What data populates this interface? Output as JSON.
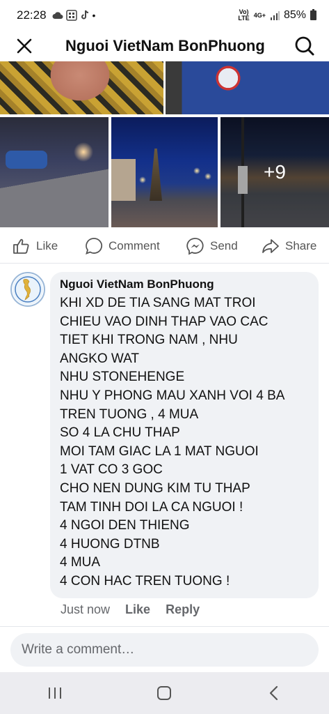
{
  "status_bar": {
    "time": "22:28",
    "lte_label_top": "Vo)",
    "lte_label_bottom": "LTE",
    "network": "4G+",
    "battery": "85%"
  },
  "header": {
    "title": "Nguoi VietNam BonPhuong",
    "close_icon": "close-icon",
    "search_icon": "search-icon"
  },
  "photos": {
    "more_count": "+9"
  },
  "actions": {
    "like": "Like",
    "comment": "Comment",
    "send": "Send",
    "share": "Share"
  },
  "comment": {
    "author": "Nguoi VietNam BonPhuong",
    "lines": [
      "KHI XD DE TIA SANG MAT TROI",
      "CHIEU VAO DINH THAP VAO CAC",
      "TIET KHI TRONG NAM , NHU",
      "ANGKO WAT",
      "NHU STONEHENGE",
      "NHU Y PHONG MAU XANH VOI 4 BA",
      "TREN TUONG , 4 MUA",
      "SO 4 LA CHU THAP",
      "MOI TAM GIAC LA 1 MAT NGUOI",
      "1 VAT CO 3 GOC",
      "CHO NEN DUNG KIM TU THAP",
      "TAM TINH DOI LA CA NGUOI !",
      "4 NGOI DEN THIENG",
      "4 HUONG DTNB",
      "4 MUA",
      "4 CON HAC TREN TUONG !"
    ],
    "time": "Just now",
    "like": "Like",
    "reply": "Reply"
  },
  "input": {
    "placeholder": "Write a comment…",
    "value": ""
  },
  "colors": {
    "accent": "#0866ff",
    "bubble": "#f0f2f5",
    "secondary_text": "#65676b"
  }
}
